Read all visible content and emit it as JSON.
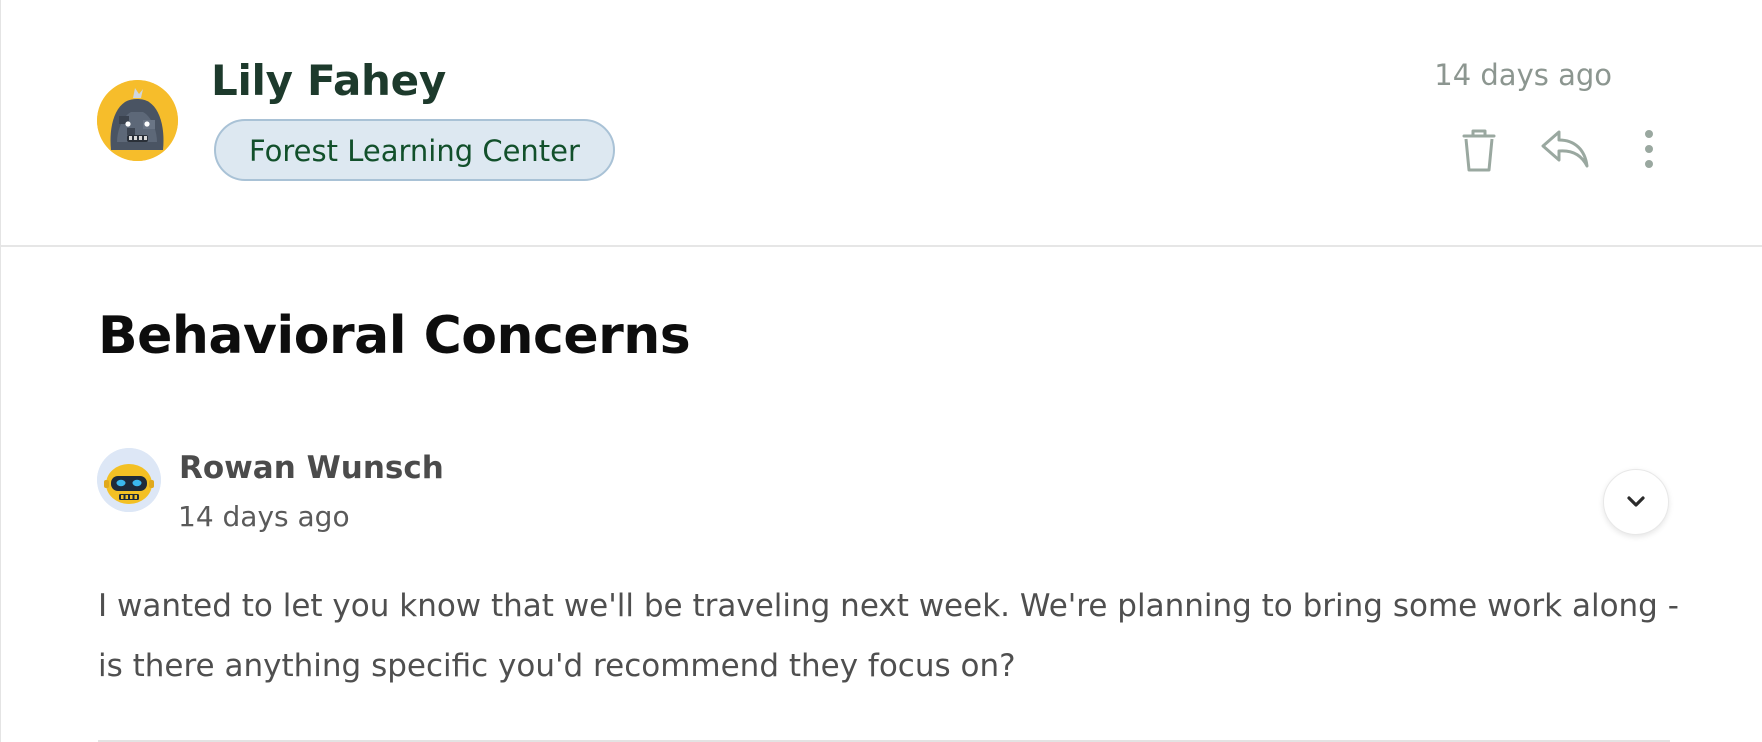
{
  "header": {
    "sender_name": "Lily Fahey",
    "organization": "Forest Learning Center",
    "timestamp": "14 days ago",
    "actions": {
      "delete_icon": "trash-icon",
      "reply_icon": "reply-icon",
      "more_icon": "more-vertical-icon"
    }
  },
  "thread": {
    "subject": "Behavioral Concerns"
  },
  "message": {
    "author": "Rowan Wunsch",
    "timestamp": "14 days ago",
    "body": "I wanted to let you know that we'll be traveling next week. We're planning to bring some work along - is there anything specific you'd recommend they focus on?",
    "expand_icon": "chevron-down-icon"
  },
  "colors": {
    "name_text": "#1d3a2c",
    "badge_bg": "#dde8f1",
    "badge_border": "#a9c2d6",
    "badge_text": "#12502b",
    "icon_gray": "#9aa8a0",
    "avatar_main_bg": "#f6bd2b",
    "avatar_msg_bg": "#dde7f6"
  }
}
